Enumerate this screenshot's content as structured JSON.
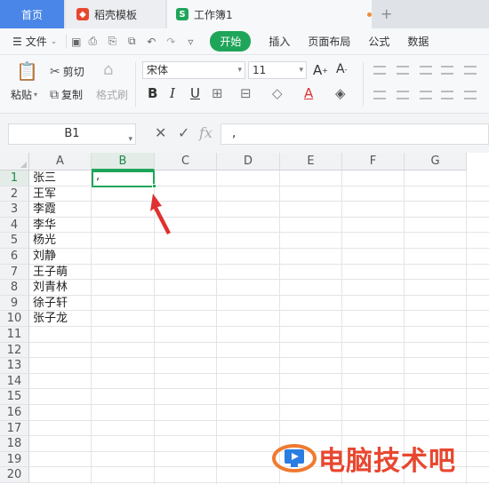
{
  "tabs": {
    "home": "首页",
    "template": "稻壳模板",
    "workbook": "工作簿1"
  },
  "menu": {
    "file": "文件",
    "items": [
      "开始",
      "插入",
      "页面布局",
      "公式",
      "数据"
    ],
    "active": "开始"
  },
  "toolbar": {
    "paste": "粘贴",
    "cut": "剪切",
    "copy": "复制",
    "format_painter": "格式刷",
    "font_name": "宋体",
    "font_size": "11",
    "bold": "B",
    "italic": "I",
    "underline": "U",
    "font_color": "A"
  },
  "formula_bar": {
    "name_box": "B1",
    "fx": "fx",
    "value": ","
  },
  "sheet": {
    "columns": [
      "A",
      "B",
      "C",
      "D",
      "E",
      "F",
      "G"
    ],
    "rows": [
      "1",
      "2",
      "3",
      "4",
      "5",
      "6",
      "7",
      "8",
      "9",
      "10",
      "11",
      "12",
      "13",
      "14",
      "15",
      "16",
      "17",
      "18",
      "19",
      "20"
    ],
    "columnA": [
      "张三",
      "王军",
      "李霞",
      "李华",
      "杨光",
      "刘静",
      "王子萌",
      "刘青林",
      "徐子轩",
      "张子龙"
    ],
    "active_cell": "B1",
    "active_value": ","
  },
  "watermark": {
    "text": "电脑技术吧"
  },
  "colors": {
    "accent_green": "#1fa55a",
    "home_tab_blue": "#4a86e8",
    "arrow_red": "#e03030",
    "watermark_red": "#e8472f"
  }
}
